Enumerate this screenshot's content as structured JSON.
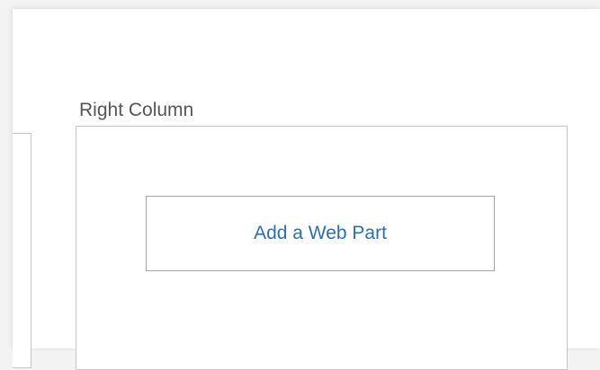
{
  "zones": {
    "right": {
      "title": "Right Column",
      "add_webpart_label": "Add a Web Part"
    }
  },
  "colors": {
    "link": "#2a6ebb",
    "zone_border": "#c8c8c8",
    "title_text": "#555555"
  }
}
